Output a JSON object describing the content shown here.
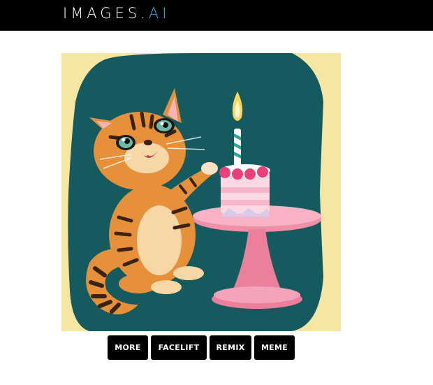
{
  "header": {
    "logo_text": "IMAGES",
    "logo_dot": ".",
    "logo_suffix": "AI",
    "background": "#000000"
  },
  "main_image": {
    "subject": "cartoon kitten with birthday cake",
    "colors": {
      "background_outer": "#f5e7a1",
      "background_blob": "#155a5e",
      "cake_stand": "#f08fa8",
      "kitten_fur": "#e6913a"
    }
  },
  "actions": {
    "more_label": "MORE",
    "facelift_label": "FACELIFT",
    "remix_label": "REMIX",
    "meme_label": "MEME"
  }
}
